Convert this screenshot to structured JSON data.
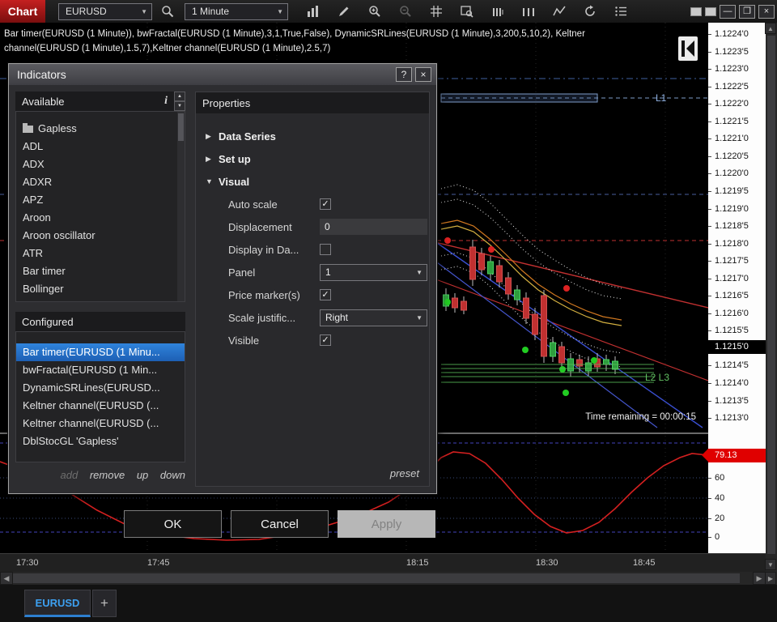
{
  "toolbar": {
    "chart_label": "Chart",
    "instrument": "EURUSD",
    "interval": "1 Minute",
    "icon_names": [
      "search",
      "bar-chart",
      "pencil",
      "zoom-in",
      "zoom-out",
      "grid",
      "chart-inspect",
      "bar-spacing-decrease",
      "bar-spacing-increase",
      "zigzag",
      "refresh",
      "list"
    ],
    "window_buttons": {
      "minimize": "—",
      "maximize": "❐",
      "close": "×"
    }
  },
  "chart": {
    "indicator_line1": "Bar timer(EURUSD (1 Minute)), bwFractal(EURUSD (1 Minute),3,1,True,False), DynamicSRLines(EURUSD (1 Minute),3,200,5,10,2), Keltner",
    "indicator_line2": "channel(EURUSD (1 Minute),1.5,7),Keltner channel(EURUSD (1 Minute),2.5,7)",
    "labels": {
      "l1": "L1",
      "l2l3": "L2 L3"
    },
    "time_remaining": "Time remaining = 00:00:15",
    "current_price": "1.1215'0",
    "price_scale": [
      "1.1224'0",
      "1.1223'5",
      "1.1223'0",
      "1.1222'5",
      "1.1222'0",
      "1.1221'5",
      "1.1221'0",
      "1.1220'5",
      "1.1220'0",
      "1.1219'5",
      "1.1219'0",
      "1.1218'5",
      "1.1218'0",
      "1.1217'5",
      "1.1217'0",
      "1.1216'5",
      "1.1216'0",
      "1.1215'5",
      "1.1215'0",
      "1.1214'5",
      "1.1214'0",
      "1.1213'5",
      "1.1213'0"
    ],
    "oscillator_value": "79.13",
    "oscillator_scale": [
      "60",
      "40",
      "20",
      "0"
    ],
    "time_axis": [
      "17:30",
      "17:45",
      "18:15",
      "18:30",
      "18:45"
    ],
    "colors": {
      "up": "#2e9e3e",
      "down": "#c03030",
      "oscillator": "#d42020",
      "current_badge": "#000000",
      "oscillator_badge": "#e00000"
    }
  },
  "dialog": {
    "title": "Indicators",
    "help_label": "?",
    "close_label": "×",
    "available": {
      "header": "Available",
      "items": [
        {
          "icon": "folder",
          "label": "Gapless"
        },
        {
          "label": "ADL"
        },
        {
          "label": "ADX"
        },
        {
          "label": "ADXR"
        },
        {
          "label": "APZ"
        },
        {
          "label": "Aroon"
        },
        {
          "label": "Aroon oscillator"
        },
        {
          "label": "ATR"
        },
        {
          "label": "Bar timer"
        },
        {
          "label": "Bollinger"
        }
      ]
    },
    "configured": {
      "header": "Configured",
      "selected_index": 0,
      "items": [
        "Bar timer(EURUSD (1 Minu...",
        "bwFractal(EURUSD (1 Min...",
        "DynamicSRLines(EURUSD...",
        "Keltner channel(EURUSD (...",
        "Keltner channel(EURUSD (...",
        "DblStocGL 'Gapless'"
      ]
    },
    "links": {
      "add": "add",
      "remove": "remove",
      "up": "up",
      "down": "down"
    },
    "properties": {
      "header": "Properties",
      "groups": [
        {
          "label": "Data Series",
          "expanded": false
        },
        {
          "label": "Set up",
          "expanded": false
        },
        {
          "label": "Visual",
          "expanded": true
        }
      ],
      "fields": [
        {
          "label": "Auto scale",
          "type": "checkbox",
          "value": true
        },
        {
          "label": "Displacement",
          "type": "input",
          "value": "0"
        },
        {
          "label": "Display in Da...",
          "type": "checkbox",
          "value": false
        },
        {
          "label": "Panel",
          "type": "select",
          "value": "1"
        },
        {
          "label": "Price marker(s)",
          "type": "checkbox",
          "value": true
        },
        {
          "label": "Scale justific...",
          "type": "select",
          "value": "Right"
        },
        {
          "label": "Visible",
          "type": "checkbox",
          "value": true
        }
      ],
      "preset_label": "preset"
    },
    "buttons": {
      "ok": "OK",
      "cancel": "Cancel",
      "apply": "Apply"
    }
  },
  "tabs": {
    "active": "EURUSD",
    "add_label": "+"
  }
}
